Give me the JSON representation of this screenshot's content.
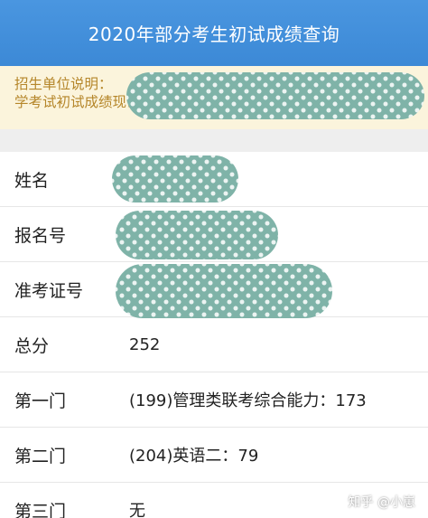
{
  "header": {
    "title": "2020年部分考生初试成绩查询"
  },
  "notice": {
    "line1_prefix": "招生单位说明：",
    "line2_prefix": "学考试初试成绩现已"
  },
  "rows": [
    {
      "label": "姓名",
      "value": "",
      "redacted": true
    },
    {
      "label": "报名号",
      "value": "",
      "redacted": true
    },
    {
      "label": "准考证号",
      "value": "",
      "redacted": true
    },
    {
      "label": "总分",
      "value": "252",
      "redacted": false
    },
    {
      "label": "第一门",
      "value": "(199)管理类联考综合能力：173",
      "redacted": false
    },
    {
      "label": "第二门",
      "value": "(204)英语二：79",
      "redacted": false
    },
    {
      "label": "第三门",
      "value": "无",
      "redacted": false
    }
  ],
  "watermark": "知乎 @小崽",
  "colors": {
    "header_bg": "#3c89d6",
    "notice_bg": "#fbf4dc",
    "notice_text": "#b5862a",
    "redaction_fill": "#7fb3a8"
  }
}
